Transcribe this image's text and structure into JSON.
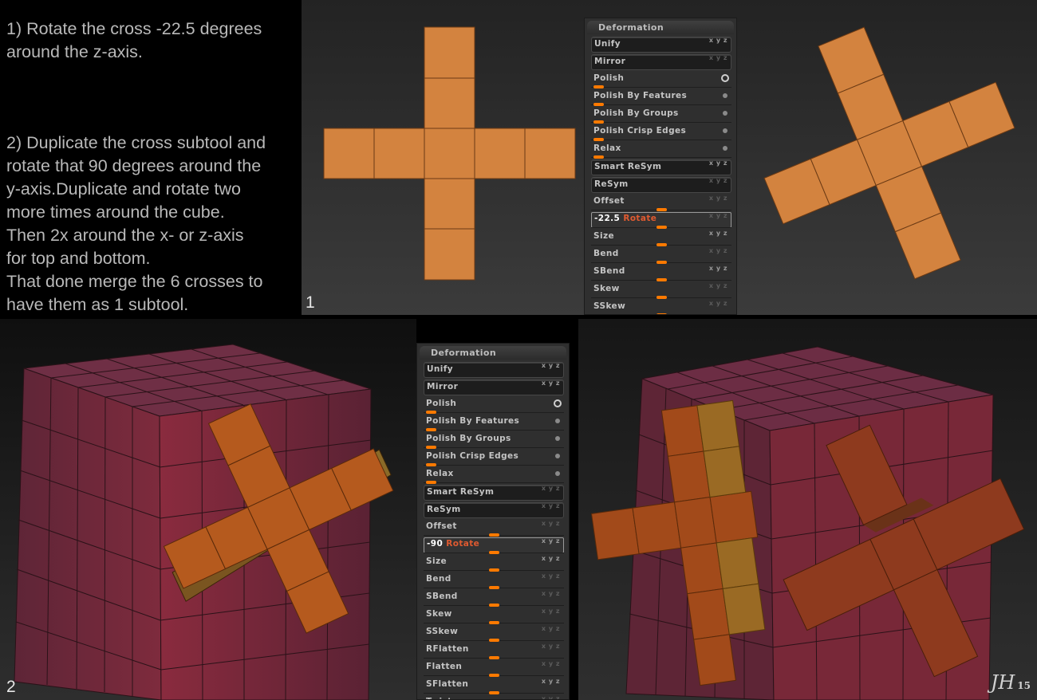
{
  "instructions": {
    "step1": "1) Rotate the cross -22.5 degrees\naround the z-axis.",
    "step2": "2) Duplicate the cross subtool and\nrotate that 90 degrees around the\ny-axis.Duplicate and rotate two\nmore times around the cube.\nThen 2x around the x- or z-axis\nfor top and bottom.\nThat done merge the 6 crosses to\nhave them as 1 subtool."
  },
  "panel_numbers": {
    "first": "1",
    "second": "2"
  },
  "signature": {
    "mark": "JH",
    "year": "15"
  },
  "colors": {
    "cross": "#d3833f",
    "cube_dark": "#6a2a3a",
    "cube_light": "#8c2a3f",
    "slider_knob": "#ff7a00"
  },
  "deformation_panels": [
    {
      "title": "Deformation",
      "rows": [
        {
          "label": "Unify",
          "kind": "button",
          "xyz": "x y z",
          "active": true
        },
        {
          "label": "Mirror",
          "kind": "button",
          "xyz": "x y z",
          "active": false
        },
        {
          "label": "Polish",
          "kind": "slider",
          "indicator": "ring",
          "level": 0.05
        },
        {
          "label": "Polish By Features",
          "kind": "slider",
          "indicator": "dot",
          "level": 0.05
        },
        {
          "label": "Polish By Groups",
          "kind": "slider",
          "indicator": "dot",
          "level": 0.05
        },
        {
          "label": "Polish Crisp Edges",
          "kind": "slider",
          "indicator": "dot",
          "level": 0.05
        },
        {
          "label": "Relax",
          "kind": "slider",
          "indicator": "dot",
          "level": 0.05
        },
        {
          "label": "Smart ReSym",
          "kind": "button",
          "xyz": "x y z",
          "active": true
        },
        {
          "label": "ReSym",
          "kind": "button",
          "xyz": "x y z",
          "active": false
        },
        {
          "label": "Offset",
          "kind": "slider",
          "xyz": "x y z",
          "active": false,
          "level": 0.5
        },
        {
          "label": "Rotate",
          "value": "-22.5",
          "kind": "field",
          "xyz": "x y z",
          "active": false,
          "level": 0.5
        },
        {
          "label": "Size",
          "kind": "slider",
          "xyz": "x y z",
          "active": true,
          "level": 0.5
        },
        {
          "label": "Bend",
          "kind": "slider",
          "xyz": "x y z",
          "active": false,
          "level": 0.5
        },
        {
          "label": "SBend",
          "kind": "slider",
          "xyz": "x y z",
          "active": true,
          "level": 0.5
        },
        {
          "label": "Skew",
          "kind": "slider",
          "xyz": "x y z",
          "active": false,
          "level": 0.5
        },
        {
          "label": "SSkew",
          "kind": "slider",
          "xyz": "x y z",
          "active": false,
          "level": 0.5
        }
      ]
    },
    {
      "title": "Deformation",
      "rows": [
        {
          "label": "Unify",
          "kind": "button",
          "xyz": "x y z",
          "active": true
        },
        {
          "label": "Mirror",
          "kind": "button",
          "xyz": "x y z",
          "active": true
        },
        {
          "label": "Polish",
          "kind": "slider",
          "indicator": "ring",
          "level": 0.05
        },
        {
          "label": "Polish By Features",
          "kind": "slider",
          "indicator": "dot",
          "level": 0.05
        },
        {
          "label": "Polish By Groups",
          "kind": "slider",
          "indicator": "dot",
          "level": 0.05
        },
        {
          "label": "Polish Crisp Edges",
          "kind": "slider",
          "indicator": "dot",
          "level": 0.05
        },
        {
          "label": "Relax",
          "kind": "slider",
          "indicator": "dot",
          "level": 0.05
        },
        {
          "label": "Smart ReSym",
          "kind": "button",
          "xyz": "x y z",
          "active": false
        },
        {
          "label": "ReSym",
          "kind": "button",
          "xyz": "x y z",
          "active": false
        },
        {
          "label": "Offset",
          "kind": "slider",
          "xyz": "x y z",
          "active": false,
          "level": 0.5
        },
        {
          "label": "Rotate",
          "value": "-90",
          "kind": "field",
          "xyz": "x y z",
          "active": true,
          "level": 0.5
        },
        {
          "label": "Size",
          "kind": "slider",
          "xyz": "x y z",
          "active": true,
          "level": 0.5
        },
        {
          "label": "Bend",
          "kind": "slider",
          "xyz": "x y z",
          "active": false,
          "level": 0.5
        },
        {
          "label": "SBend",
          "kind": "slider",
          "xyz": "x y z",
          "active": false,
          "level": 0.5
        },
        {
          "label": "Skew",
          "kind": "slider",
          "xyz": "x y z",
          "active": false,
          "level": 0.5
        },
        {
          "label": "SSkew",
          "kind": "slider",
          "xyz": "x y z",
          "active": false,
          "level": 0.5
        },
        {
          "label": "RFlatten",
          "kind": "slider",
          "xyz": "x y z",
          "active": false,
          "level": 0.5
        },
        {
          "label": "Flatten",
          "kind": "slider",
          "xyz": "x y z",
          "active": false,
          "level": 0.5
        },
        {
          "label": "SFlatten",
          "kind": "slider",
          "xyz": "x y z",
          "active": true,
          "level": 0.5
        },
        {
          "label": "Twist",
          "kind": "slider",
          "xyz": "x y z",
          "active": false,
          "level": 0.5
        }
      ]
    }
  ]
}
